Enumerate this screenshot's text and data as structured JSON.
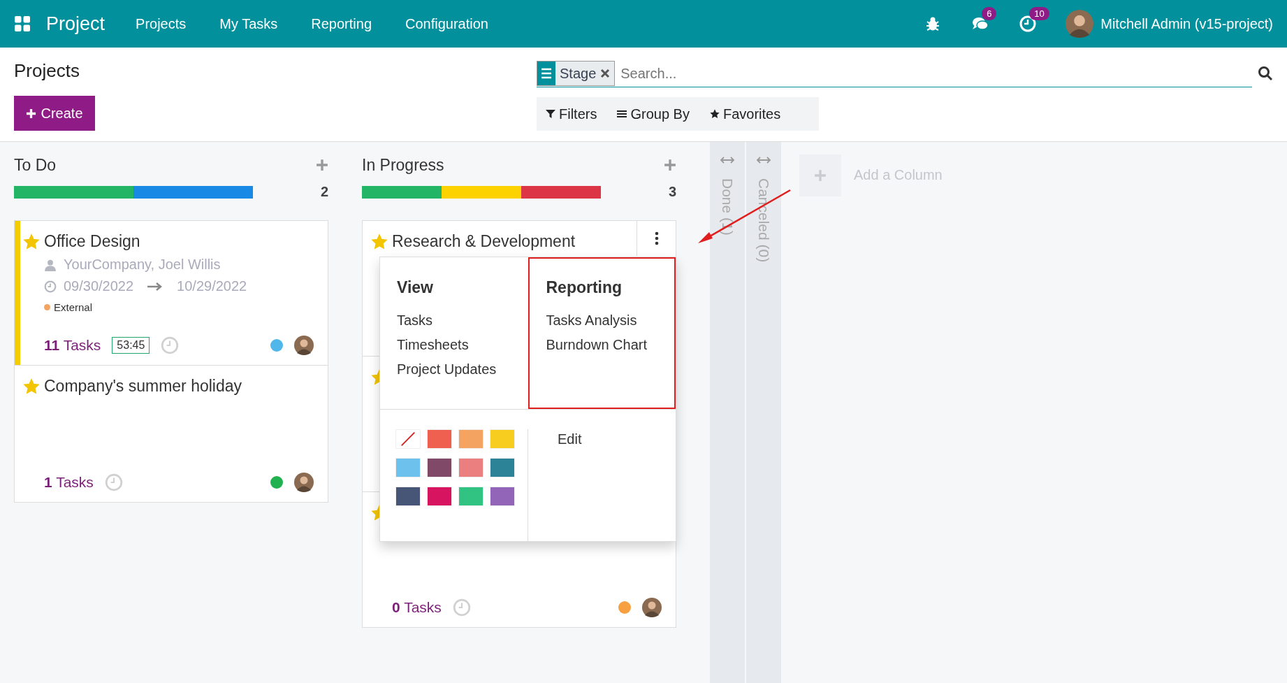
{
  "navbar": {
    "app_name": "Project",
    "menu": [
      "Projects",
      "My Tasks",
      "Reporting",
      "Configuration"
    ],
    "messages_badge": "6",
    "activities_badge": "10",
    "user": "Mitchell Admin (v15-project)"
  },
  "control_panel": {
    "title": "Projects",
    "create_label": "Create",
    "facet": {
      "label": "Stage"
    },
    "search": {
      "placeholder": "Search..."
    },
    "filter_buttons": [
      {
        "label": "Filters",
        "kind": "filter"
      },
      {
        "label": "Group By",
        "kind": "group"
      },
      {
        "label": "Favorites",
        "kind": "favorite"
      }
    ]
  },
  "columns": [
    {
      "title": "To Do",
      "count": "2",
      "progress": [
        {
          "color": "#21b565"
        },
        {
          "color": "#1989e6"
        }
      ],
      "cards": [
        {
          "name": "Office Design",
          "favorite": true,
          "color": "#f4cd00",
          "partner": "YourCompany, Joel Willis",
          "date_start": "09/30/2022",
          "date_end": "10/29/2022",
          "tags": [
            {
              "label": "External",
              "color": "#f4a460"
            }
          ],
          "tasks": "**11** Tasks",
          "timer": "53:45",
          "status": {
            "color": "#4fb7ea"
          }
        },
        {
          "name": "Company's summer holiday",
          "favorite": true,
          "tasks": "**1** Tasks",
          "status": {
            "color": "#21b24f"
          }
        }
      ]
    },
    {
      "title": "In Progress",
      "count": "3",
      "progress": [
        {
          "color": "#21b565"
        },
        {
          "color": "#fcd200"
        },
        {
          "color": "#dc3545"
        }
      ],
      "cards": [
        {
          "name": "Research & Development",
          "favorite": true,
          "menu_open": true
        },
        {
          "favorite": true
        },
        {
          "favorite": true,
          "tasks": "**0** Tasks",
          "status": {
            "color": "#f7a041"
          }
        }
      ]
    }
  ],
  "folded_columns": [
    {
      "title": "Done (1)"
    },
    {
      "title": "Canceled (0)"
    }
  ],
  "add_column": {
    "label": "Add a Column"
  },
  "card_menu": {
    "sections": [
      {
        "title": "View",
        "items": [
          "Tasks",
          "Timesheets",
          "Project Updates"
        ]
      },
      {
        "title": "Reporting",
        "items": [
          "Tasks Analysis",
          "Burndown Chart"
        ],
        "highlighted": true
      }
    ],
    "swatches": [
      {
        "kind": "none"
      },
      {
        "kind": "color",
        "color": "#f06050"
      },
      {
        "kind": "color",
        "color": "#f4a460"
      },
      {
        "kind": "color",
        "color": "#f7cd1f"
      },
      {
        "kind": "color",
        "color": "#6cc1ed"
      },
      {
        "kind": "color",
        "color": "#814968"
      },
      {
        "kind": "color",
        "color": "#eb7e7f"
      },
      {
        "kind": "color",
        "color": "#2c8397"
      },
      {
        "kind": "color",
        "color": "#475577"
      },
      {
        "kind": "color",
        "color": "#d6145f"
      },
      {
        "kind": "color",
        "color": "#30c381"
      },
      {
        "kind": "color",
        "color": "#9365b8"
      }
    ],
    "edit_label": "Edit"
  }
}
